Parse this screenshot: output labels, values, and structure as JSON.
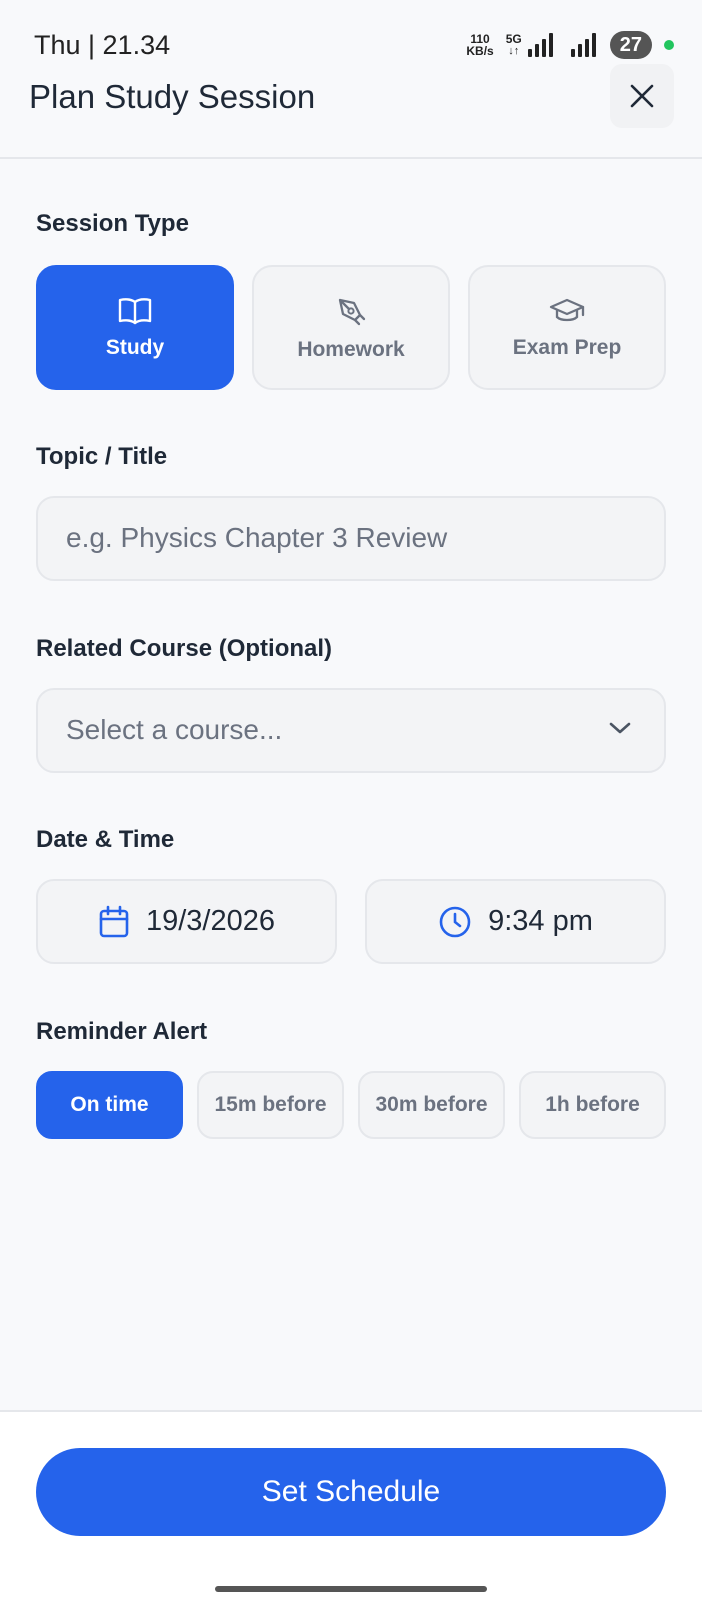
{
  "status_bar": {
    "time": "Thu | 21.34",
    "net_speed_value": "110",
    "net_speed_unit": "KB/s",
    "network_type": "5G",
    "battery": "27"
  },
  "header": {
    "title": "Plan Study Session",
    "close_icon": "close-icon"
  },
  "session_type": {
    "label": "Session Type",
    "options": [
      {
        "label": "Study",
        "icon": "book-icon",
        "selected": true
      },
      {
        "label": "Homework",
        "icon": "pen-icon",
        "selected": false
      },
      {
        "label": "Exam Prep",
        "icon": "graduation-cap-icon",
        "selected": false
      }
    ]
  },
  "topic": {
    "label": "Topic / Title",
    "placeholder": "e.g. Physics Chapter 3 Review",
    "value": ""
  },
  "course": {
    "label": "Related Course (Optional)",
    "placeholder": "Select a course..."
  },
  "datetime": {
    "label": "Date & Time",
    "date": "19/3/2026",
    "time": "9:34 pm"
  },
  "reminder": {
    "label": "Reminder Alert",
    "options": [
      {
        "label": "On time",
        "selected": true
      },
      {
        "label": "15m before",
        "selected": false
      },
      {
        "label": "30m before",
        "selected": false
      },
      {
        "label": "1h before",
        "selected": false
      }
    ]
  },
  "footer": {
    "cta_label": "Set Schedule"
  },
  "colors": {
    "accent": "#2563eb",
    "background": "#f8f9fb",
    "field_bg": "#f3f4f6",
    "muted_text": "#6b7280"
  }
}
